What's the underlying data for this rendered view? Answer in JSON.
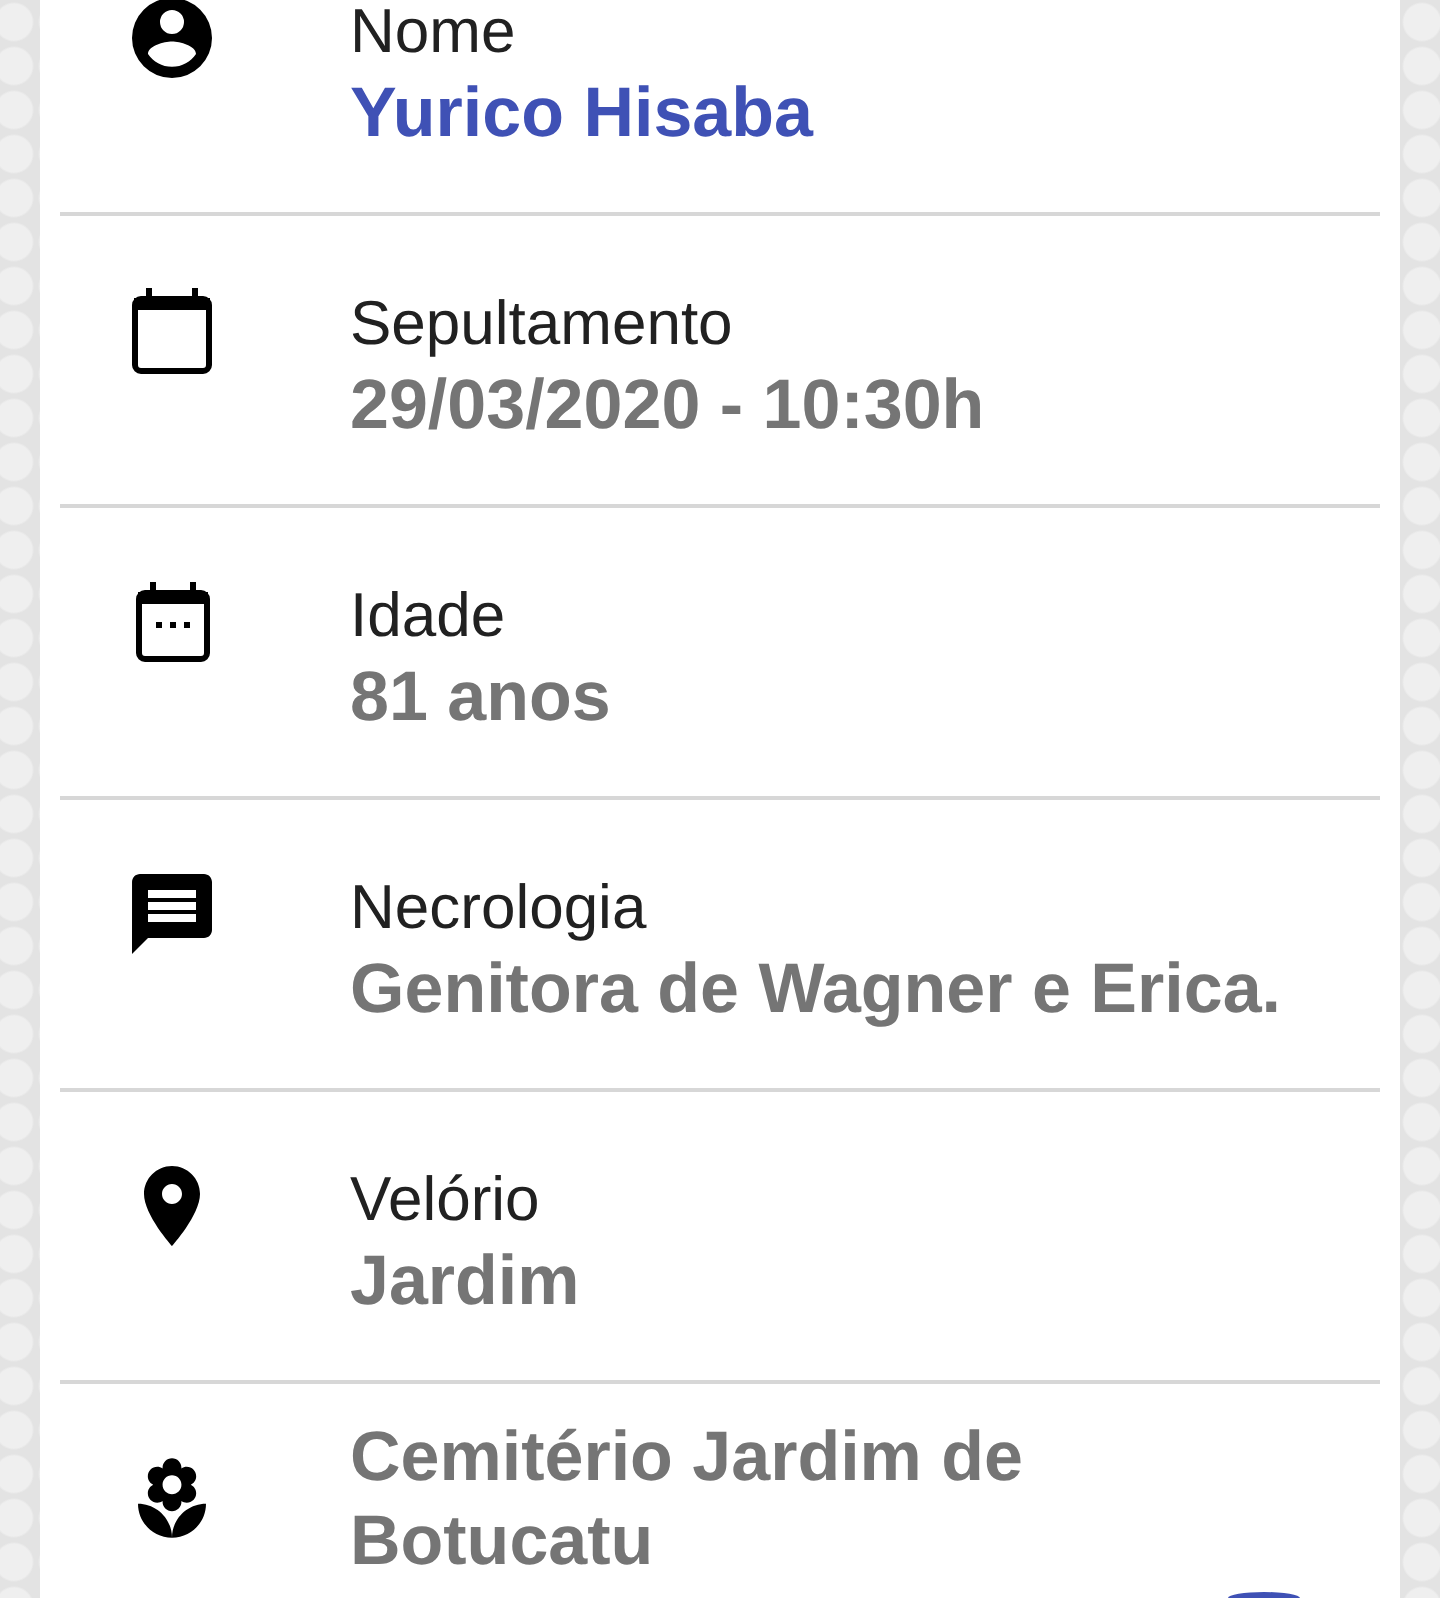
{
  "details": [
    {
      "kind": "name",
      "label": "Nome",
      "value": "Yurico Hisaba",
      "highlighted": true
    },
    {
      "kind": "burial",
      "label": "Sepultamento",
      "value": "29/03/2020 - 10:30h",
      "highlighted": false
    },
    {
      "kind": "age",
      "label": "Idade",
      "value": "81 anos",
      "highlighted": false
    },
    {
      "kind": "obituary",
      "label": "Necrologia",
      "value": "Genitora de Wagner e Erica.",
      "highlighted": false
    },
    {
      "kind": "wake",
      "label": "Velório",
      "value": "Jardim",
      "highlighted": false
    },
    {
      "kind": "cemetery",
      "value": "Cemitério Jardim de Botucatu",
      "highlighted": false
    }
  ]
}
